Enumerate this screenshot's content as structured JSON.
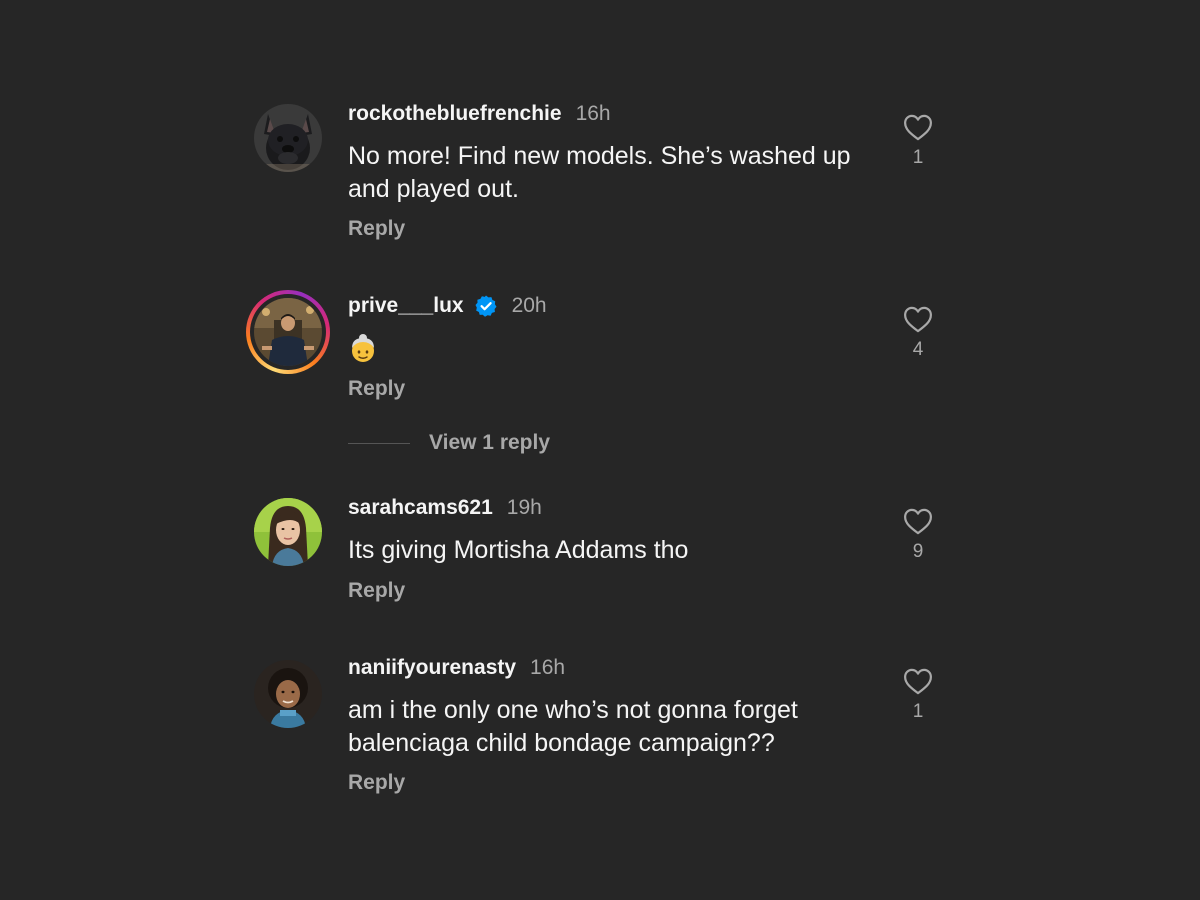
{
  "comments": [
    {
      "username": "rockothebluefrenchie",
      "time": "16h",
      "text": "No more! Find new models. She’s washed up and played out.",
      "reply_label": "Reply",
      "likes": "1",
      "avatar": "french-bulldog-photo"
    },
    {
      "username": "prive___lux",
      "verified": true,
      "time": "20h",
      "text_emoji": "older-person-emoji",
      "reply_label": "Reply",
      "likes": "4",
      "avatar": "man-photo-with-story-ring",
      "view_replies_label": "View 1 reply"
    },
    {
      "username": "sarahcams621",
      "time": "19h",
      "text": "Its giving Mortisha Addams tho",
      "reply_label": "Reply",
      "likes": "9",
      "avatar": "woman-photo-green-background"
    },
    {
      "username": "naniifyourenasty",
      "time": "16h",
      "text": "am i the only one who’s not gonna forget balenciaga child bondage campaign??",
      "reply_label": "Reply",
      "likes": "1",
      "avatar": "child-photo"
    }
  ],
  "colors": {
    "background": "#262626",
    "primary_text": "#f5f5f5",
    "secondary_text": "#a8a8a8",
    "verified_blue": "#0095f6"
  }
}
